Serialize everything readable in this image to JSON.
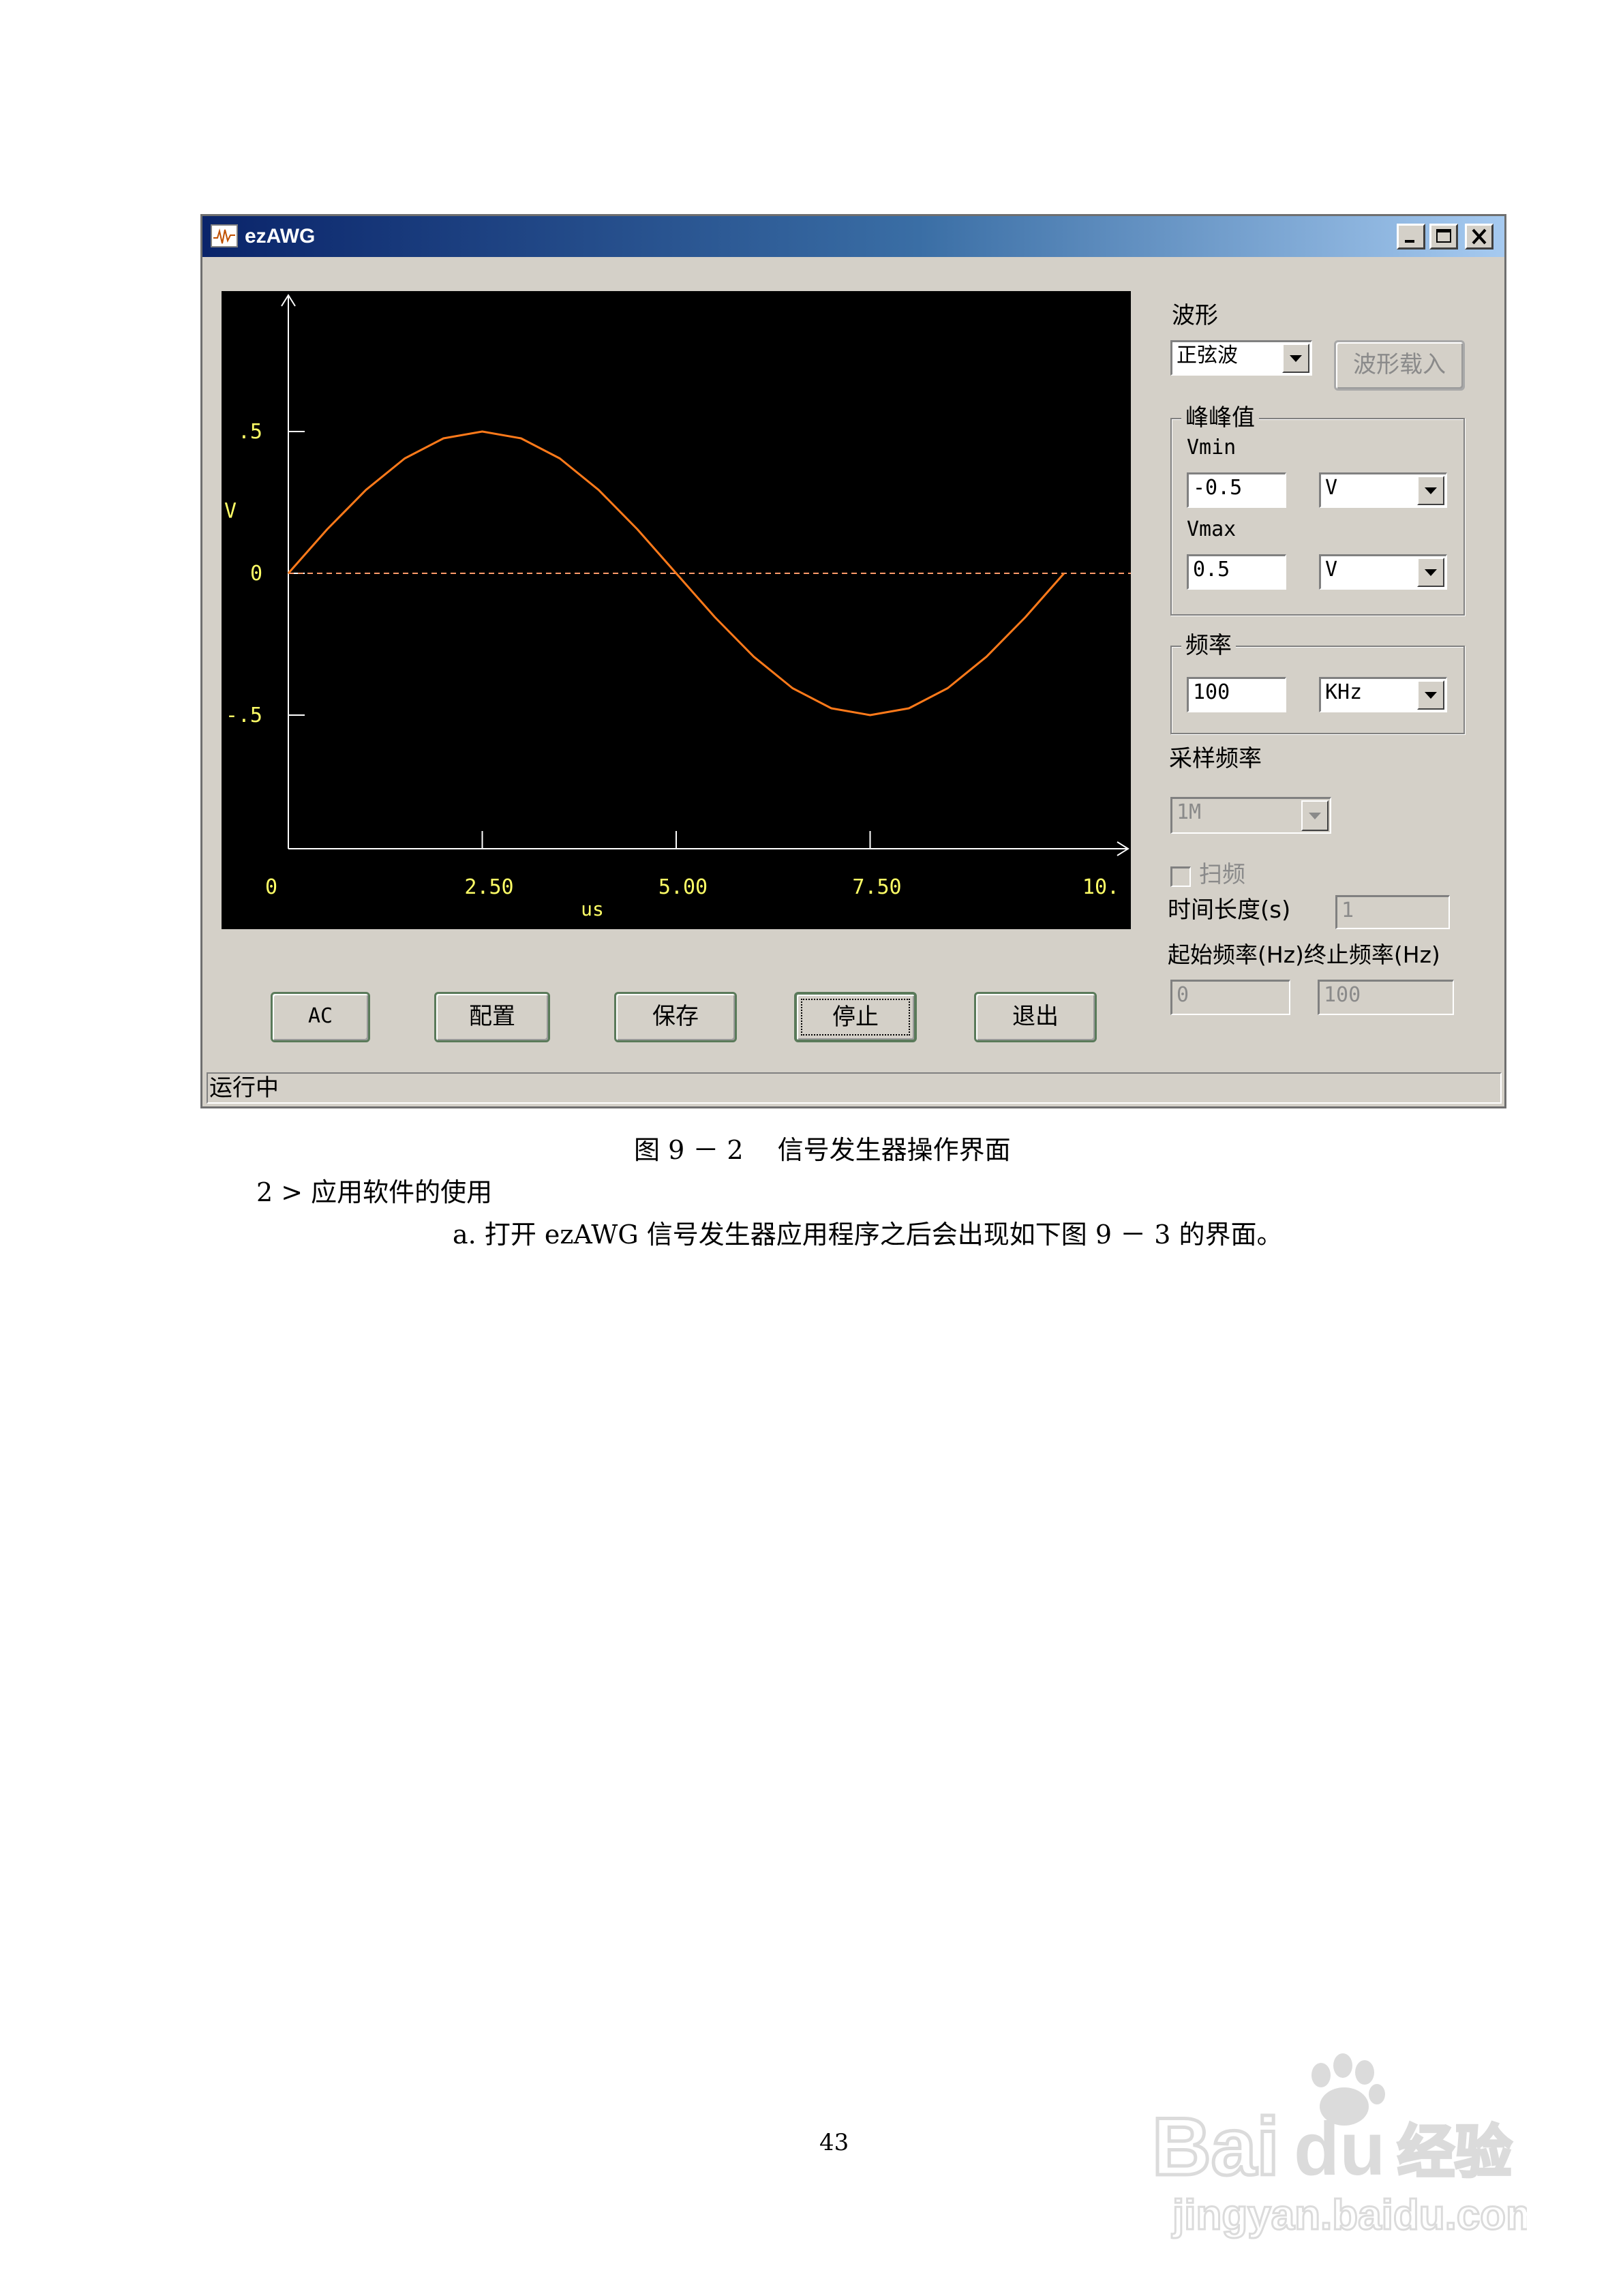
{
  "window": {
    "title": "ezAWG",
    "status_text": "运行中"
  },
  "plot": {
    "y_ticks": [
      ".5",
      "0",
      "-.5"
    ],
    "y_label": "V",
    "x_ticks": [
      "0",
      "2.50",
      "5.00",
      "7.50",
      "10."
    ],
    "x_label": "us",
    "colors": {
      "background": "#000000",
      "axes": "#ffffff",
      "labels": "#ffff66",
      "trace": "#ff7a1a",
      "zero_line": "#ff9a6a"
    }
  },
  "chart_data": {
    "type": "line",
    "xlabel": "us",
    "ylabel": "V",
    "xlim": [
      0,
      10
    ],
    "ylim": [
      -1,
      1
    ],
    "x_tick_labels": [
      "0",
      "2.50",
      "5.00",
      "7.50",
      "10."
    ],
    "y_tick_labels": [
      ".5",
      "0",
      "-.5"
    ],
    "grid": false,
    "series": [
      {
        "x": [
          0,
          0.5,
          1,
          1.5,
          2,
          2.5,
          3,
          3.5,
          4,
          4.5,
          5,
          5.5,
          6,
          6.5,
          7,
          7.5,
          8,
          8.5,
          9,
          9.5,
          10
        ],
        "values": [
          0,
          0.155,
          0.294,
          0.405,
          0.476,
          0.5,
          0.476,
          0.405,
          0.294,
          0.155,
          0,
          -0.155,
          -0.294,
          -0.405,
          -0.476,
          -0.5,
          -0.476,
          -0.405,
          -0.294,
          -0.155,
          0
        ]
      }
    ],
    "reference_line": {
      "y": 0,
      "style": "dashed"
    }
  },
  "panel": {
    "waveform_label": "波形",
    "waveform_value": "正弦波",
    "load_waveform_button": "波形载入",
    "peak_group_title": "峰峰值",
    "vmin_label": "Vmin",
    "vmin_value": "-0.5",
    "vmin_unit": "V",
    "vmax_label": "Vmax",
    "vmax_value": "0.5",
    "vmax_unit": "V",
    "freq_group_title": "频率",
    "freq_value": "100",
    "freq_unit": "KHz",
    "sample_rate_label": "采样频率",
    "sample_rate_value": "1M",
    "sweep_label": "扫频",
    "duration_label": "时间长度(s)",
    "duration_value": "1",
    "start_stop_label": "起始频率(Hz)终止频率(Hz)",
    "start_freq_value": "0",
    "stop_freq_value": "100"
  },
  "buttons": {
    "ac": "AC",
    "config": "配置",
    "save": "保存",
    "stop": "停止",
    "exit": "退出"
  },
  "document": {
    "caption": "图 9 － 2　 信号发生器操作界面",
    "section": "2 > 应用软件的使用",
    "paragraph": "a.  打开 ezAWG 信号发生器应用程序之后会出现如下图 9 － 3 的界面。",
    "page_number": "43"
  },
  "watermark": {
    "brand": "Bai du 经验",
    "url": "jingyan.baidu.com"
  }
}
